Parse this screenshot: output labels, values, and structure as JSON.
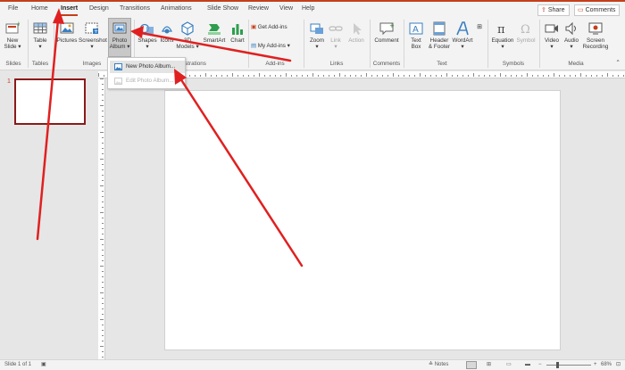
{
  "tabs": [
    "File",
    "Home",
    "Insert",
    "Design",
    "Transitions",
    "Animations",
    "Slide Show",
    "Review",
    "View",
    "Help"
  ],
  "active_tab": "Insert",
  "share_label": "Share",
  "comments_label": "Comments",
  "ribbon": {
    "new_slide": "New",
    "new_slide_2": "Slide",
    "table": "Table",
    "pictures": "Pictures",
    "screenshot": "Screenshot",
    "photo_album": "Photo",
    "photo_album_2": "Album",
    "shapes": "Shapes",
    "icons": "Icons",
    "models_3d": "3D",
    "models_3d_2": "Models",
    "smartart": "SmartArt",
    "chart": "Chart",
    "get_addins": "Get Add-ins",
    "my_addins": "My Add-ins",
    "zoom": "Zoom",
    "link": "Link",
    "action": "Action",
    "comment": "Comment",
    "text_box": "Text",
    "text_box_2": "Box",
    "header_footer": "Header",
    "header_footer_2": "& Footer",
    "wordart": "WordArt",
    "equation": "Equation",
    "symbol": "Symbol",
    "video": "Video",
    "audio": "Audio",
    "screen_recording": "Screen",
    "screen_recording_2": "Recording"
  },
  "groups": {
    "slides": "Slides",
    "tables": "Tables",
    "images": "Images",
    "illustrations": "Illustrations",
    "addins": "Add-ins",
    "links": "Links",
    "comments": "Comments",
    "text": "Text",
    "symbols": "Symbols",
    "media": "Media"
  },
  "dropdown": {
    "new_photo_album": "New Photo Album...",
    "edit_photo_album": "Edit Photo Album..."
  },
  "thumbnail_number": "1",
  "status": {
    "slide_info": "Slide 1 of 1",
    "notes": "Notes",
    "zoom_level": "68%"
  },
  "colors": {
    "accent": "#c43e1c",
    "arrow": "#e02020",
    "thumb_border": "#8b1a1a"
  }
}
